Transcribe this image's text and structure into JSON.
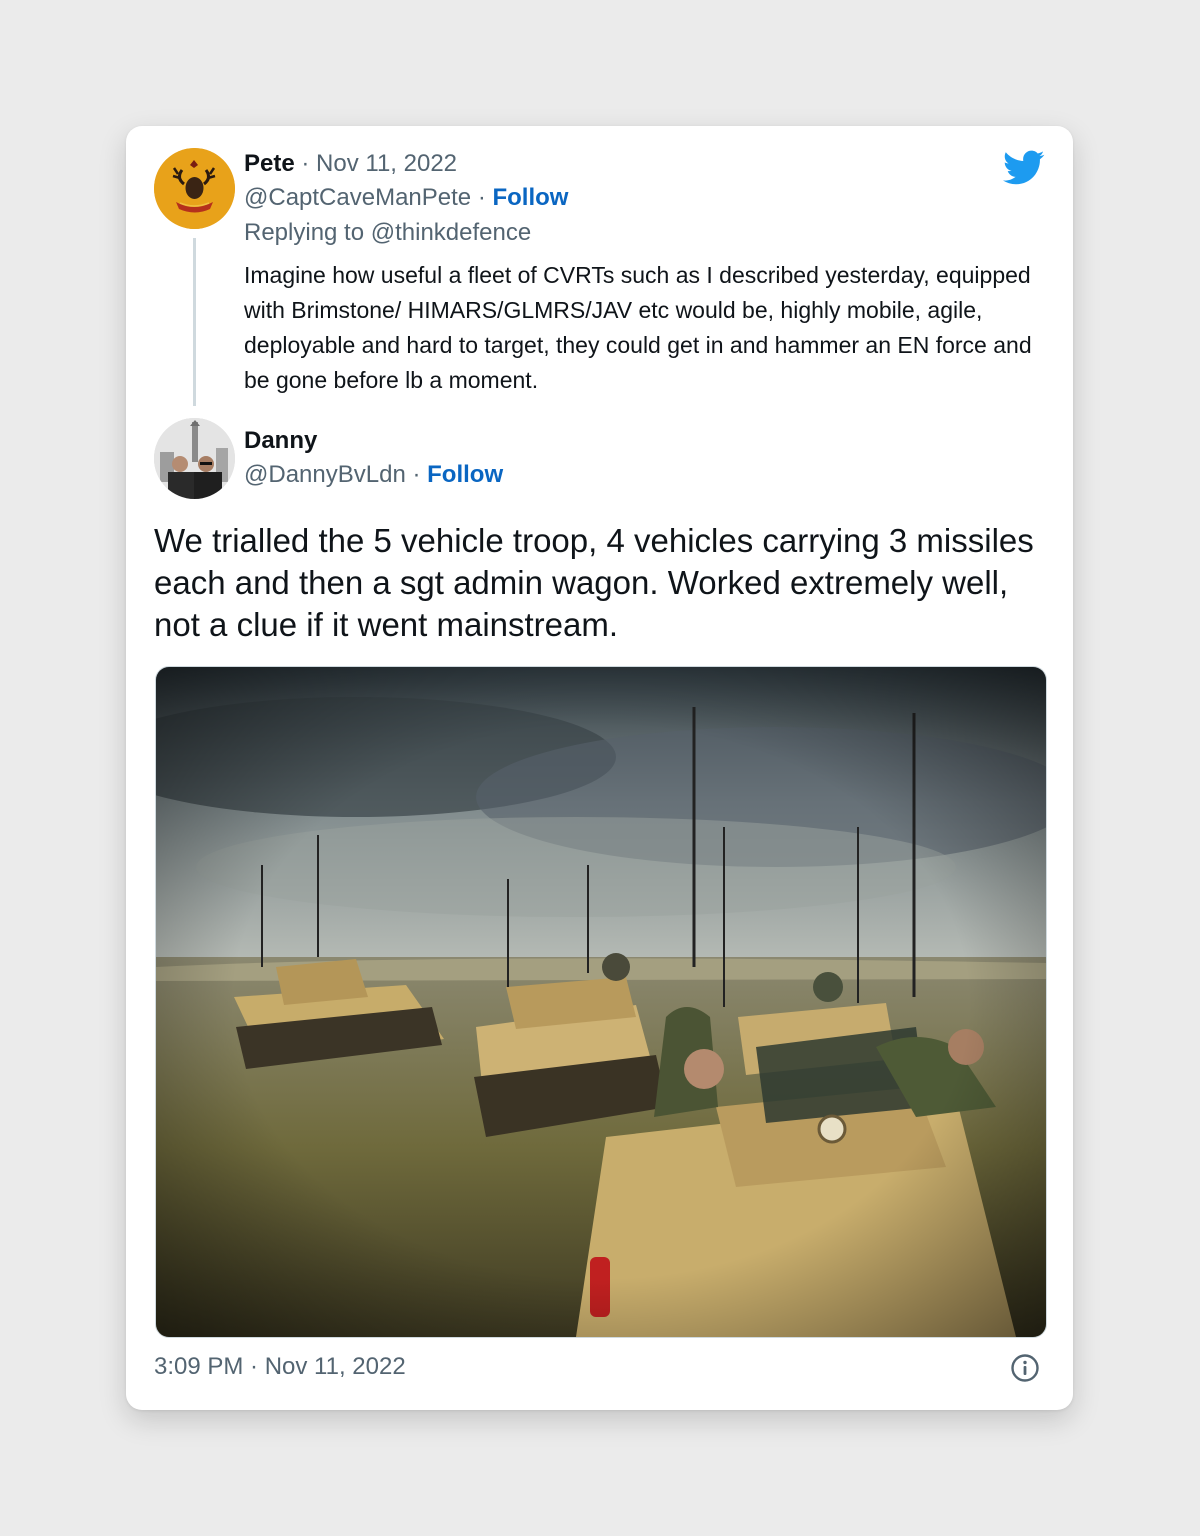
{
  "parent_tweet": {
    "author_name": "Pete",
    "date": "Nov 11, 2022",
    "handle": "@CaptCaveManPete",
    "follow_label": "Follow",
    "replying_to": "Replying to @thinkdefence",
    "text": "Imagine how useful a fleet of CVRTs such as I described yesterday, equipped with Brimstone/ HIMARS/GLMRS/JAV etc would be, highly mobile, agile, deployable and hard to target, they could get in and hammer an EN force and be gone before lb a moment."
  },
  "main_tweet": {
    "author_name": "Danny",
    "handle": "@DannyBvLdn",
    "follow_label": "Follow",
    "text": "We trialled the 5 vehicle troop, 4 vehicles carrying 3 missiles each and then a sgt admin wagon. Worked extremely well, not a clue if it went mainstream.",
    "timestamp": "3:09 PM · Nov 11, 2022"
  },
  "separator": " · ",
  "icons": {
    "brand": "twitter-bird-icon",
    "info": "info-icon"
  },
  "colors": {
    "brand_blue": "#1d9bf0",
    "follow_blue": "#0a66c2",
    "text_primary": "#0f1419",
    "text_muted": "#536471"
  }
}
